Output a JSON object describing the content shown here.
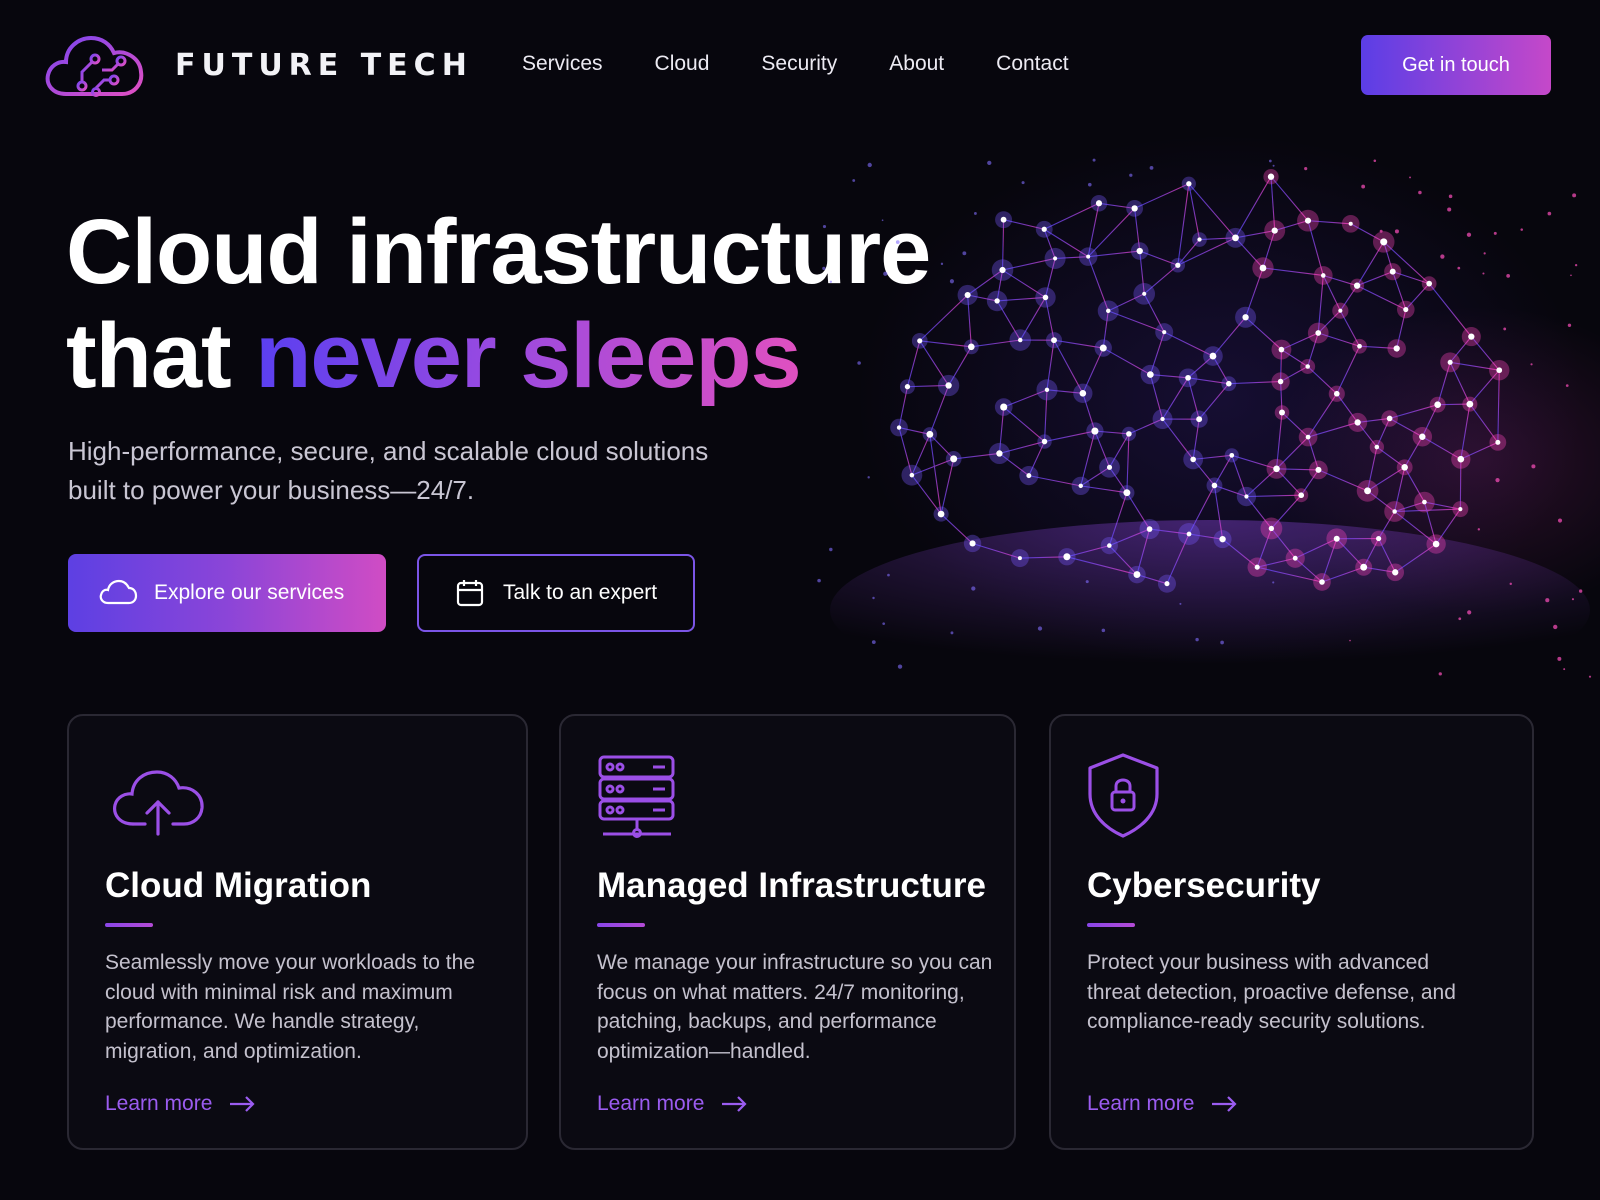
{
  "header": {
    "brand": "FUTURE TECH",
    "nav": [
      {
        "label": "Services"
      },
      {
        "label": "Cloud"
      },
      {
        "label": "Security"
      },
      {
        "label": "About"
      },
      {
        "label": "Contact"
      }
    ],
    "cta_label": "Get in touch"
  },
  "hero": {
    "title_line1": "Cloud infrastructure",
    "title_line2_plain": "that ",
    "title_line2_gradient": "never sleeps",
    "subtitle_line1": "High-performance, secure, and scalable cloud solutions",
    "subtitle_line2": "built to power your business—24/7.",
    "primary_button": {
      "label": "Explore our services",
      "icon": "cloud-icon"
    },
    "secondary_button": {
      "label": "Talk to an expert",
      "icon": "calendar-icon"
    }
  },
  "cards": [
    {
      "icon": "cloud-upload-icon",
      "title": "Cloud Migration",
      "description": "Seamlessly move your workloads to the cloud with minimal risk and maximum performance. We handle strategy, migration, and optimization.",
      "link": "Learn more"
    },
    {
      "icon": "server-rack-icon",
      "title": "Managed Infrastructure",
      "description": "We manage your infrastructure so you can focus on what matters. 24/7 monitoring, patching, backups, and performance optimization—handled.",
      "link": "Learn more"
    },
    {
      "icon": "shield-lock-icon",
      "title": "Cybersecurity",
      "description": "Protect your business with advanced threat detection, proactive defense, and compliance-ready security solutions.",
      "link": "Learn more"
    }
  ],
  "colors": {
    "background": "#07060d",
    "accent_purple": "#5b3ee6",
    "accent_magenta": "#d04cc4",
    "link": "#9b5cf0",
    "card_border": "#2a2833"
  }
}
